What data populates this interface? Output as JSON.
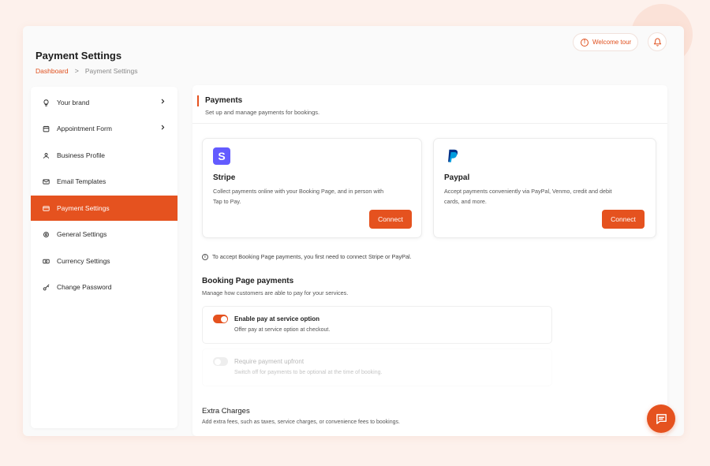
{
  "header": {
    "title": "Payment Settings",
    "breadcrumb": {
      "root": "Dashboard",
      "separator": ">",
      "current": "Payment Settings"
    },
    "welcome_tour": "Welcome tour",
    "welcome_icon": "!"
  },
  "sidebar": {
    "items": [
      {
        "label": "Your brand",
        "icon": "bulb-icon",
        "has_chevron": true
      },
      {
        "label": "Appointment Form",
        "icon": "calendar-icon",
        "has_chevron": true
      },
      {
        "label": "Business Profile",
        "icon": "user-icon",
        "has_chevron": false
      },
      {
        "label": "Email Templates",
        "icon": "mail-icon",
        "has_chevron": false
      },
      {
        "label": "Payment Settings",
        "icon": "card-icon",
        "has_chevron": false,
        "active": true
      },
      {
        "label": "General Settings",
        "icon": "gear-icon",
        "has_chevron": false
      },
      {
        "label": "Currency Settings",
        "icon": "currency-icon",
        "has_chevron": false
      },
      {
        "label": "Change Password",
        "icon": "key-icon",
        "has_chevron": false
      }
    ]
  },
  "payments": {
    "title": "Payments",
    "subtitle": "Set up and manage payments for bookings.",
    "providers": [
      {
        "name": "Stripe",
        "description_line1": "Collect payments online with your Booking Page, and in person with",
        "description_line2": "Tap to Pay.",
        "button": "Connect",
        "logo_letter": "S"
      },
      {
        "name": "Paypal",
        "description_line1": "Accept payments conveniently via PayPal, Venmo, credit and debit",
        "description_line2": "cards, and more.",
        "button": "Connect"
      }
    ],
    "note": "To accept Booking Page payments, you first need to connect Stripe or PayPal.",
    "note_icon": "i"
  },
  "booking": {
    "title": "Booking Page payments",
    "subtitle": "Manage how customers are able to pay for your services.",
    "options": [
      {
        "title": "Enable pay at service option",
        "subtitle": "Offer pay at service option at checkout.",
        "enabled": true,
        "disabled": false
      },
      {
        "title": "Require payment upfront",
        "subtitle": "Switch off for payments to be optional at the time of booking.",
        "enabled": false,
        "disabled": true
      }
    ]
  },
  "extra": {
    "title": "Extra Charges",
    "subtitle": "Add extra fees, such as taxes, service charges, or convenience fees to bookings."
  },
  "colors": {
    "accent": "#e5521f",
    "stripe": "#635bff",
    "paypal_dark": "#003087",
    "paypal_light": "#009cde"
  }
}
